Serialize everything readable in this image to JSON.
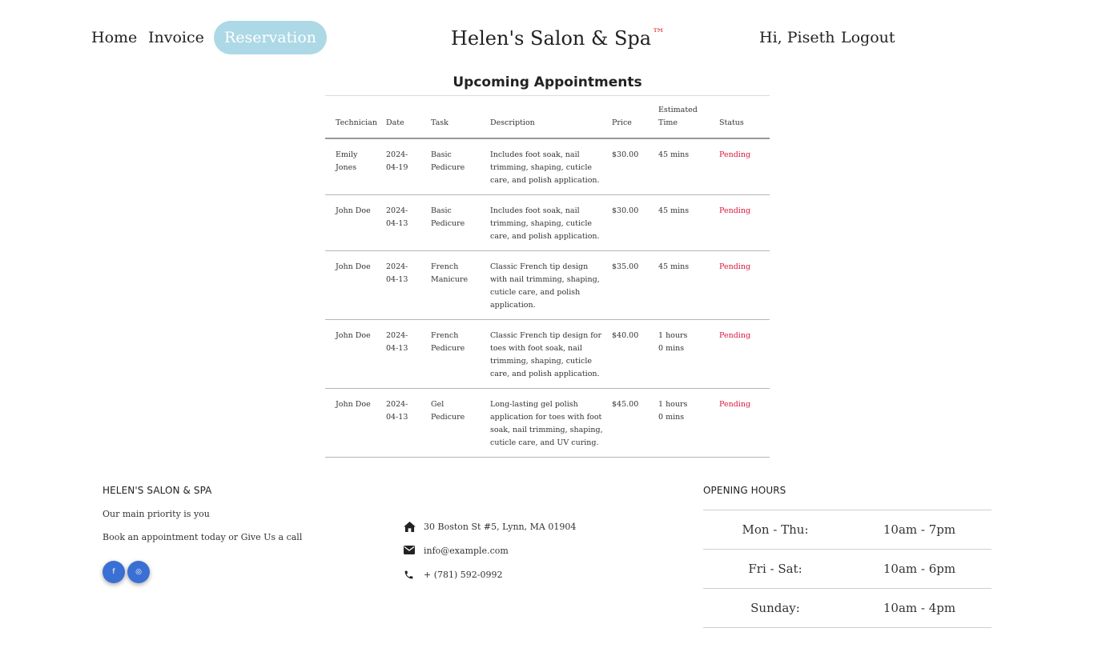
{
  "nav": {
    "home": "Home",
    "invoice": "Invoice",
    "reservation": "Reservation",
    "brand": "Helen's Salon & Spa",
    "trademark": "™",
    "greeting": "Hi, Piseth",
    "logout": "Logout"
  },
  "appointments": {
    "title": "Upcoming Appointments",
    "headers": [
      "Technician",
      "Date",
      "Task",
      "Description",
      "Price",
      "Estimated Time",
      "Status"
    ],
    "rows": [
      {
        "technician": "Emily Jones",
        "date": "2024-04-19",
        "task": "Basic Pedicure",
        "description": "Includes foot soak, nail trimming, shaping, cuticle care, and polish application.",
        "price": "$30.00",
        "time": "45 mins",
        "status": "Pending"
      },
      {
        "technician": "John Doe",
        "date": "2024-04-13",
        "task": "Basic Pedicure",
        "description": "Includes foot soak, nail trimming, shaping, cuticle care, and polish application.",
        "price": "$30.00",
        "time": "45 mins",
        "status": "Pending"
      },
      {
        "technician": "John Doe",
        "date": "2024-04-13",
        "task": "French Manicure",
        "description": "Classic French tip design with nail trimming, shaping, cuticle care, and polish application.",
        "price": "$35.00",
        "time": "45 mins",
        "status": "Pending"
      },
      {
        "technician": "John Doe",
        "date": "2024-04-13",
        "task": "French Pedicure",
        "description": "Classic French tip design for toes with foot soak, nail trimming, shaping, cuticle care, and polish application.",
        "price": "$40.00",
        "time": "1 hours 0 mins",
        "status": "Pending"
      },
      {
        "technician": "John Doe",
        "date": "2024-04-13",
        "task": "Gel Pedicure",
        "description": "Long-lasting gel polish application for toes with foot soak, nail trimming, shaping, cuticle care, and UV curing.",
        "price": "$45.00",
        "time": "1 hours 0 mins",
        "status": "Pending"
      }
    ]
  },
  "footer": {
    "about_heading": "HELEN'S SALON & SPA",
    "tagline": "Our main priority is you",
    "cta": "Book an appointment today or Give Us a call",
    "social": {
      "facebook": "f",
      "instagram": "◎"
    },
    "address": "30 Boston St #5, Lynn, MA 01904",
    "email": "info@example.com",
    "phone": "+ (781) 592-0992",
    "hours_heading": "OPENING HOURS",
    "hours": [
      {
        "days": "Mon - Thu:",
        "time": "10am - 7pm"
      },
      {
        "days": "Fri - Sat:",
        "time": "10am - 6pm"
      },
      {
        "days": "Sunday:",
        "time": "10am - 4pm"
      }
    ]
  },
  "colors": {
    "reservation_bg": "#add8e6",
    "trademark": "#e0393e",
    "status_pending": "#dc143c",
    "social_button": "#3a70d4"
  },
  "icons": {
    "address": "home-icon",
    "email": "envelope-icon",
    "phone": "phone-icon"
  }
}
